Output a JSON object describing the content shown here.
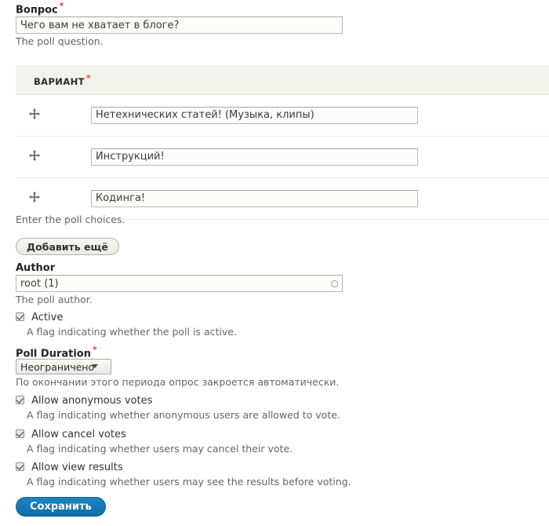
{
  "question": {
    "label": "Вопрос",
    "required_mark": "*",
    "value": "Чего вам не хватает в блоге?",
    "description": "The poll question."
  },
  "choices": {
    "header": "ВАРИАНТ",
    "required_mark": "*",
    "drag_icon": "move-arrows-icon",
    "rows": [
      {
        "value": "Нетехнических статей! (Музыка, клипы)"
      },
      {
        "value": "Инструкций!"
      },
      {
        "value": "Кодинга!"
      }
    ],
    "description": "Enter the poll choices.",
    "add_more_label": "Добавить ещё"
  },
  "author": {
    "label": "Author",
    "value": "root (1)",
    "description": "The poll author.",
    "throbber_icon": "autocomplete-throbber-icon"
  },
  "active": {
    "label": "Active",
    "checked": true,
    "description": "A flag indicating whether the poll is active."
  },
  "duration": {
    "label": "Poll Duration",
    "required_mark": "*",
    "selected": "Неограничено",
    "options": [
      "Неограничено"
    ],
    "description": "По окончании этого периода опрос закроется автоматически."
  },
  "flags": [
    {
      "label": "Allow anonymous votes",
      "checked": true,
      "description": "A flag indicating whether anonymous users are allowed to vote."
    },
    {
      "label": "Allow cancel votes",
      "checked": true,
      "description": "A flag indicating whether users may cancel their vote."
    },
    {
      "label": "Allow view results",
      "checked": true,
      "description": "A flag indicating whether users may see the results before voting."
    }
  ],
  "save": {
    "label": "Сохранить"
  },
  "colors": {
    "required": "#e23f28",
    "primary_button": "#1276b2",
    "table_header_bg": "#f3f3ee",
    "field_border": "#b8b8b8",
    "description_text": "#666666"
  }
}
